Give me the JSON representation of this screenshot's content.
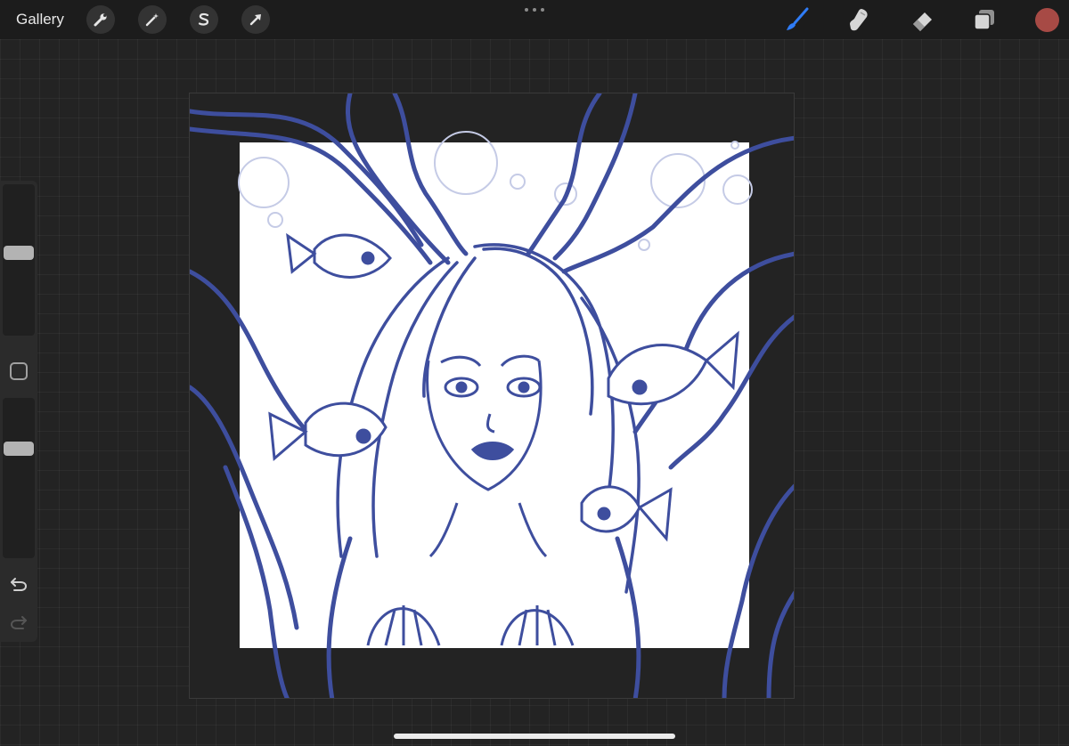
{
  "topbar": {
    "gallery_label": "Gallery",
    "left_tools": [
      {
        "name": "actions",
        "icon": "wrench-icon"
      },
      {
        "name": "adjustments",
        "icon": "magic-wand-icon"
      },
      {
        "name": "selection",
        "icon": "selection-s-icon"
      },
      {
        "name": "transform",
        "icon": "arrow-cursor-icon"
      }
    ],
    "more_icon": "more-dots-icon",
    "right_tools": [
      {
        "name": "brush",
        "icon": "brush-icon",
        "active": true,
        "color": "#2f7cf6"
      },
      {
        "name": "smudge",
        "icon": "smudge-finger-icon",
        "active": false
      },
      {
        "name": "eraser",
        "icon": "eraser-icon",
        "active": false
      },
      {
        "name": "layers",
        "icon": "layers-icon",
        "active": false
      }
    ],
    "current_color": "#a74a45"
  },
  "sidebar": {
    "brush_size_level": 0.55,
    "opacity_level": 0.7,
    "modify_icon": "square-outline-icon",
    "undo_icon": "undo-icon",
    "redo_icon": "redo-icon",
    "redo_enabled": false
  },
  "canvas": {
    "artwork": "mermaid-line-drawing",
    "stroke_color": "#3e4e9e",
    "paper_color": "#ffffff"
  }
}
